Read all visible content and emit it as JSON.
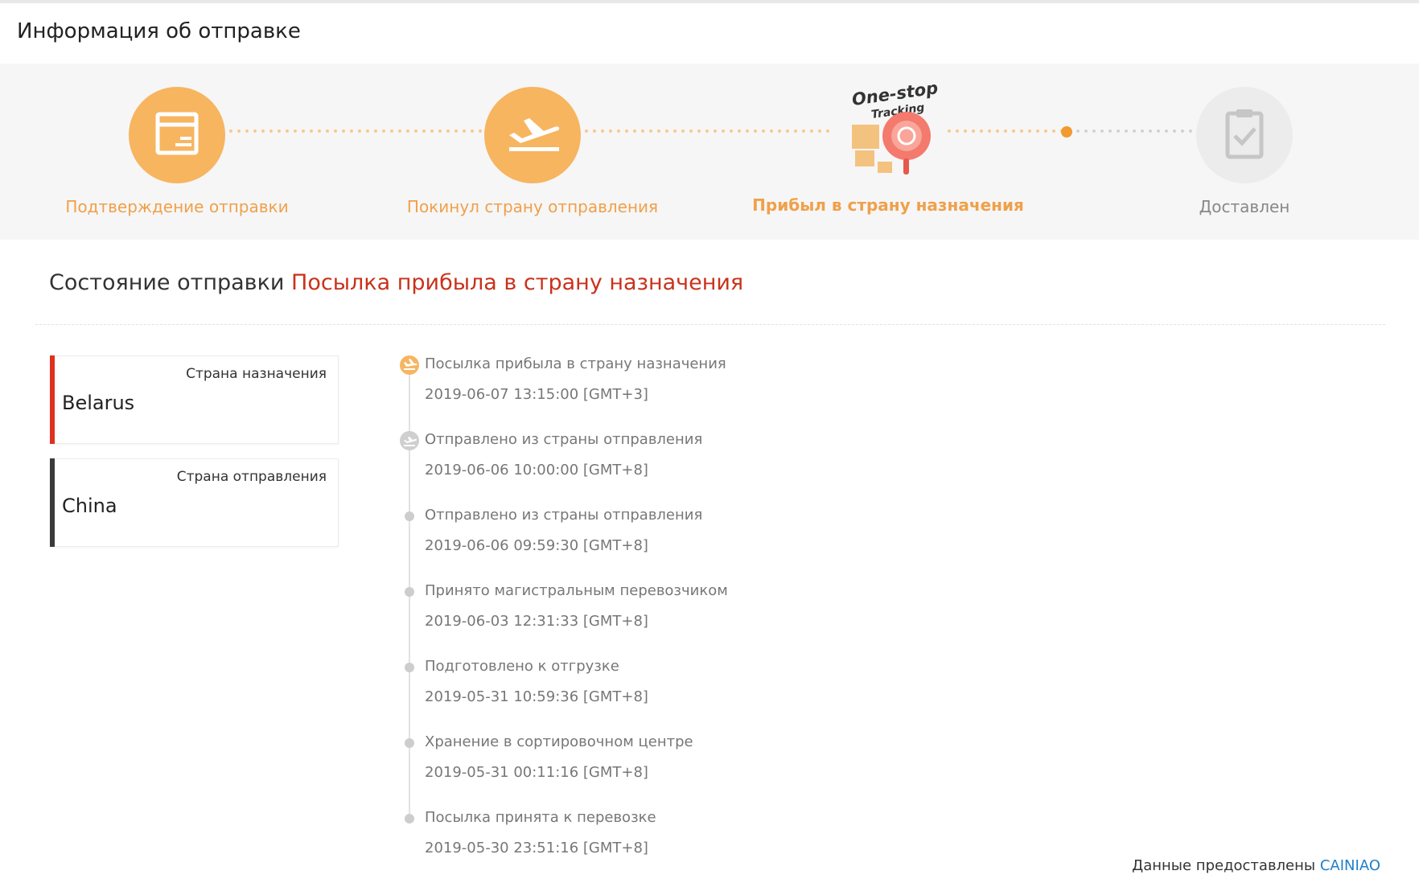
{
  "page_title": "Информация об отправке",
  "steps": [
    {
      "label": "Подтверждение отправки",
      "icon": "package-icon",
      "state": "done"
    },
    {
      "label": "Покинул страну отправления",
      "icon": "plane-departure-icon",
      "state": "done"
    },
    {
      "label": "Прибыл в страну назначения",
      "icon": "one-stop-tracking-logo",
      "state": "current"
    },
    {
      "label": "Доставлен",
      "icon": "clipboard-check-icon",
      "state": "pending"
    }
  ],
  "logo_text": {
    "line1": "One-stop",
    "line2": "Tracking"
  },
  "status": {
    "label": "Состояние отправки",
    "value": "Посылка прибыла в страну назначения"
  },
  "countries": [
    {
      "type": "Страна назначения",
      "name": "Belarus"
    },
    {
      "type": "Страна отправления",
      "name": "China"
    }
  ],
  "events": [
    {
      "title": "Посылка прибыла в страну назначения",
      "time": "2019-06-07 13:15:00 [GMT+3]"
    },
    {
      "title": "Отправлено из страны отправления",
      "time": "2019-06-06 10:00:00 [GMT+8]"
    },
    {
      "title": "Отправлено из страны отправления",
      "time": "2019-06-06 09:59:30 [GMT+8]"
    },
    {
      "title": "Принято магистральным перевозчиком",
      "time": "2019-06-03 12:31:33 [GMT+8]"
    },
    {
      "title": "Подготовлено к отгрузке",
      "time": "2019-05-31 10:59:36 [GMT+8]"
    },
    {
      "title": "Хранение в сортировочном центре",
      "time": "2019-05-31 00:11:16 [GMT+8]"
    },
    {
      "title": "Посылка принята к перевозке",
      "time": "2019-05-30 23:51:16 [GMT+8]"
    }
  ],
  "provider": {
    "prefix": "Данные предоставлены",
    "link": "CAINIAO"
  },
  "colors": {
    "accent": "#f7b560",
    "status": "#c9321b",
    "link": "#1e7fc8",
    "pending": "#ececec"
  }
}
